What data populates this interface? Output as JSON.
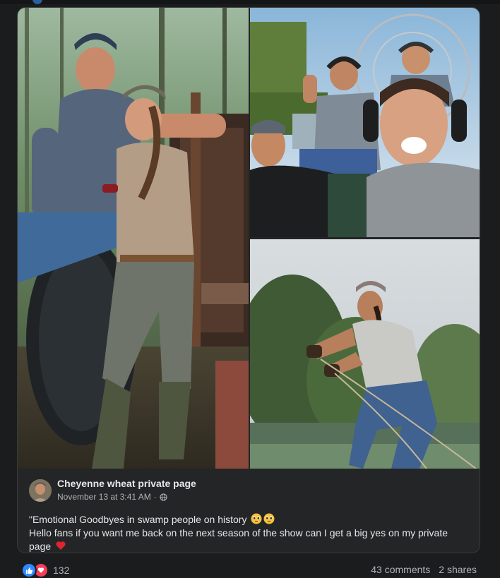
{
  "shared_post": {
    "author": "Cheyenne wheat private page",
    "date": "November 13 at 3:41 AM",
    "separator": "·",
    "text_line1": "\"Emotional Goodbyes in swamp people on history",
    "text_line2": "Hello fans if you want me back on the next season of the show can I get a big yes on my private",
    "text_line3": "page"
  },
  "photos": [
    {
      "id": "photo-1",
      "subject": "man and woman posing by airboat tire"
    },
    {
      "id": "photo-2",
      "subject": "group selfie on airboat"
    },
    {
      "id": "photo-3",
      "subject": "woman pulling rope near swamp"
    }
  ],
  "icons": {
    "privacy": "globe-icon",
    "emoji_1": "pleading-face-emoji",
    "emoji_2": "pleading-face-emoji",
    "emoji_3": "red-heart-emoji",
    "reaction_1": "like-icon",
    "reaction_2": "love-icon"
  },
  "footer": {
    "reaction_count": "132",
    "comments": "43 comments",
    "shares": "2 shares"
  },
  "colors": {
    "background": "#1b1c1e",
    "card": "#242526",
    "text_primary": "#e4e6eb",
    "text_secondary": "#b0b3b8",
    "like_blue": "#2d88ff",
    "love_red": "#f33e58"
  }
}
